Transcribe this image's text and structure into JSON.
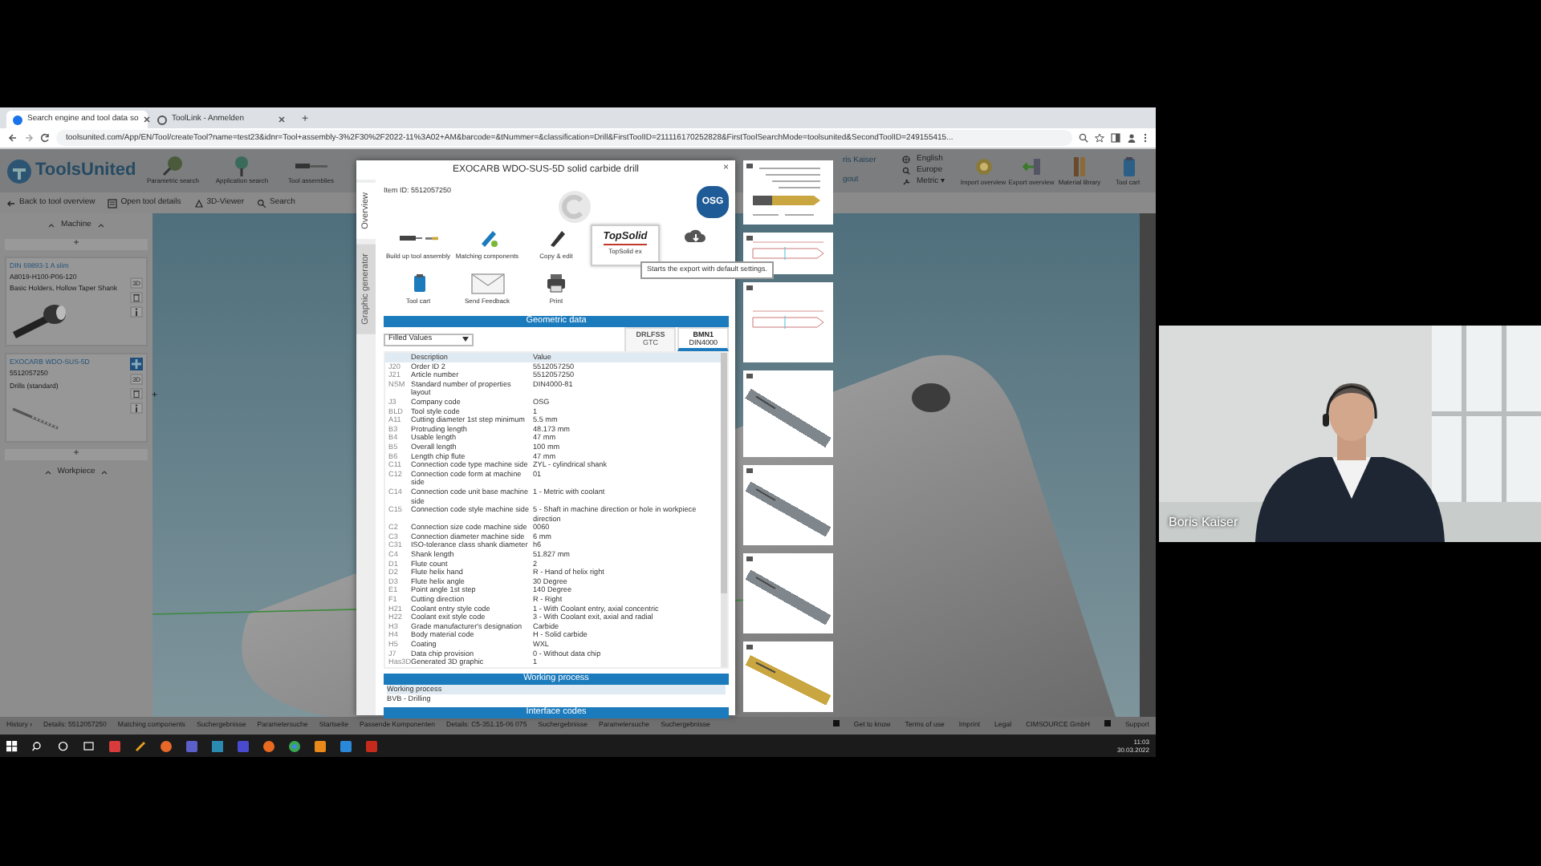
{
  "browser": {
    "tabs": [
      {
        "label": "Search engine and tool data so",
        "selected": true
      },
      {
        "label": "ToolLink - Anmelden",
        "selected": false
      }
    ],
    "new_tab": "+",
    "url": "toolsunited.com/App/EN/Tool/createTool?name=test23&idnr=Tool+assembly-3%2F30%2F2022-11%3A02+AM&barcode=&tNummer=&classification=Drill&FirstToolID=211116170252828&FirstToolSearchMode=toolsunited&SecondToolID=249155415..."
  },
  "app": {
    "logo": "ToolsUnited",
    "nav": [
      "Parametric search",
      "Application search",
      "Tool assemblies"
    ],
    "user": "ris Kaiser",
    "logout": "gout",
    "settings": [
      "English",
      "Europe",
      "Metric ▾"
    ],
    "actions": [
      {
        "kind": "import",
        "label": "Import overview"
      },
      {
        "kind": "export",
        "label": "Export overview"
      },
      {
        "kind": "library",
        "label": "Material library"
      },
      {
        "kind": "cart",
        "label": "Tool cart"
      }
    ]
  },
  "toolbar": [
    {
      "kind": "back",
      "label": "Back to tool overview"
    },
    {
      "kind": "details",
      "label": "Open tool details"
    },
    {
      "kind": "viewer",
      "label": "3D-Viewer"
    },
    {
      "kind": "search",
      "label": "Search"
    }
  ],
  "assembly": {
    "top": "Machine",
    "add": "+",
    "bottom": "Workpiece",
    "components": [
      {
        "kind": "holder",
        "title": "DIN 69893-1 A slim",
        "code": "A8019-H100-P06-120",
        "description": "Basic Holders, Hollow Taper Shank",
        "view": "3D"
      },
      {
        "kind": "drill",
        "title": "EXOCARB WDO-SUS-5D",
        "code": "5512057250",
        "description": "Drills (standard)",
        "view": "3D",
        "side_add": "+"
      }
    ]
  },
  "dialog": {
    "title": "EXOCARB WDO-SUS-5D solid carbide drill",
    "close": "×",
    "item_id": "Item ID: 5512057250",
    "brand": "OSG",
    "side_tabs": [
      {
        "label": "Overview",
        "selected": true
      },
      {
        "label": "Graphic generator",
        "selected": false
      }
    ],
    "actions": [
      {
        "kind": "assembly",
        "label": "Build up tool assembly"
      },
      {
        "kind": "matching",
        "label": "Matching components"
      },
      {
        "kind": "edit",
        "label": "Copy & edit"
      },
      {
        "kind": "topsolid",
        "logo": "TopSolid",
        "label": "TopSolid ex"
      },
      {
        "kind": "download"
      },
      {
        "kind": "cart",
        "label": "Tool cart"
      },
      {
        "kind": "feedback",
        "label": "Send Feedback"
      },
      {
        "kind": "print",
        "label": "Print"
      }
    ],
    "tooltip": "Starts the export with default settings.",
    "geometric": {
      "title": "Geometric data",
      "filter": "Filled Values",
      "standards": [
        {
          "name": "DRLFSS",
          "source": "GTC",
          "selected": false
        },
        {
          "name": "BMN1",
          "source": "DIN4000",
          "selected": true
        }
      ],
      "columns": [
        "",
        "Description",
        "Value"
      ],
      "rows": [
        [
          "J20",
          "Order ID 2",
          "5512057250"
        ],
        [
          "J21",
          "Article number",
          "5512057250"
        ],
        [
          "NSM",
          "Standard number of properties layout",
          "DIN4000-81"
        ],
        [
          "J3",
          "Company code",
          "OSG"
        ],
        [
          "BLD",
          "Tool style code",
          "1"
        ],
        [
          "A11",
          "Cutting diameter 1st step minimum",
          "5.5 mm"
        ],
        [
          "B3",
          "Protruding length",
          "48.173 mm"
        ],
        [
          "B4",
          "Usable length",
          "47 mm"
        ],
        [
          "B5",
          "Overall length",
          "100 mm"
        ],
        [
          "B6",
          "Length chip flute",
          "47 mm"
        ],
        [
          "C11",
          "Connection code type machine side",
          "ZYL - cylindrical shank"
        ],
        [
          "C12",
          "Connection code form at machine side",
          "01"
        ],
        [
          "C14",
          "Connection code unit base machine side",
          "1 - Metric with coolant"
        ],
        [
          "C15",
          "Connection code style machine side",
          "5 - Shaft in machine direction or hole in workpiece direction"
        ],
        [
          "C2",
          "Connection size code machine side",
          "0060"
        ],
        [
          "C3",
          "Connection diameter machine side",
          "6 mm"
        ],
        [
          "C31",
          "ISO-tolerance class shank diameter",
          "h6"
        ],
        [
          "C4",
          "Shank length",
          "51.827 mm"
        ],
        [
          "D1",
          "Flute count",
          "2"
        ],
        [
          "D2",
          "Flute helix hand",
          "R - Hand of helix right"
        ],
        [
          "D3",
          "Flute helix angle",
          "30 Degree"
        ],
        [
          "E1",
          "Point angle 1st step",
          "140 Degree"
        ],
        [
          "F1",
          "Cutting direction",
          "R - Right"
        ],
        [
          "H21",
          "Coolant entry style code",
          "1 - With Coolant entry, axial concentric"
        ],
        [
          "H22",
          "Coolant exit style code",
          "3 - With Coolant exit, axial and radial"
        ],
        [
          "H3",
          "Grade manufacturer's designation",
          "Carbide"
        ],
        [
          "H4",
          "Body material code",
          "H - Solid carbide"
        ],
        [
          "H5",
          "Coating",
          "WXL"
        ],
        [
          "J7",
          "Data chip provision",
          "0 - Without data chip"
        ],
        [
          "Has3D",
          "Generated 3D graphic",
          "1"
        ]
      ]
    },
    "working": {
      "title": "Working process",
      "label": "Working process",
      "value": "BVB - Drilling"
    },
    "interface": {
      "title": "Interface codes"
    }
  },
  "thumbnails": [
    {
      "kind": "dimension"
    },
    {
      "kind": "sketch"
    },
    {
      "kind": "sketch"
    },
    {
      "kind": "render",
      "color": "#7f868c"
    },
    {
      "kind": "render",
      "color": "#7f868c"
    },
    {
      "kind": "render",
      "color": "#7f868c"
    },
    {
      "kind": "render",
      "color": "#c9a640"
    }
  ],
  "status_bar": {
    "history": "History ›",
    "items": [
      "Details: 5512057250",
      "Matching components",
      "Suchergebnisse",
      "Parametersuche",
      "Startseite",
      "Passende Komponenten",
      "Details: C5-351.15-06 075",
      "Suchergebnisse",
      "Parametersuche",
      "Suchergebnisse"
    ],
    "links": [
      "Get to know",
      "Terms of use",
      "Imprint",
      "Legal",
      "CIMSOURCE GmbH",
      "Support"
    ]
  },
  "taskbar": {
    "time": "11:03",
    "date": "30.03.2022"
  },
  "video": {
    "name": "Boris Kaiser"
  }
}
